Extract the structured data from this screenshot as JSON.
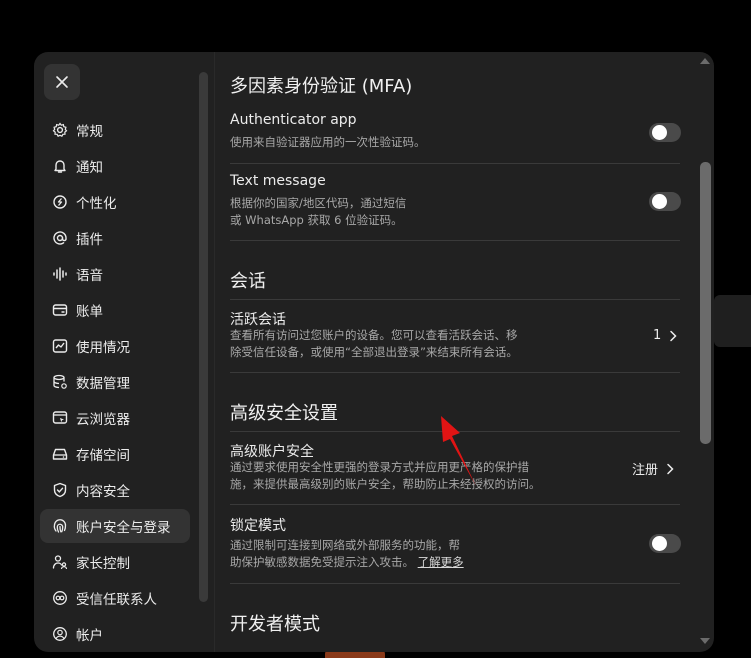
{
  "sidebar": {
    "close_icon": "close-icon",
    "items": [
      {
        "label": "常规",
        "icon": "gear-icon"
      },
      {
        "label": "通知",
        "icon": "bell-icon"
      },
      {
        "label": "个性化",
        "icon": "personalization-icon"
      },
      {
        "label": "插件",
        "icon": "at-icon"
      },
      {
        "label": "语音",
        "icon": "waveform-icon"
      },
      {
        "label": "账单",
        "icon": "card-icon"
      },
      {
        "label": "使用情况",
        "icon": "chart-icon"
      },
      {
        "label": "数据管理",
        "icon": "database-icon"
      },
      {
        "label": "云浏览器",
        "icon": "browser-icon"
      },
      {
        "label": "存储空间",
        "icon": "storage-icon"
      },
      {
        "label": "内容安全",
        "icon": "shield-icon"
      },
      {
        "label": "账户安全与登录",
        "icon": "fingerprint-icon",
        "active": true
      },
      {
        "label": "家长控制",
        "icon": "parent-icon"
      },
      {
        "label": "受信任联系人",
        "icon": "contacts-icon"
      },
      {
        "label": "帐户",
        "icon": "account-icon"
      }
    ]
  },
  "mfa": {
    "title": "多因素身份验证 (MFA)",
    "authenticator": {
      "title": "Authenticator app",
      "desc": "使用来自验证器应用的一次性验证码。",
      "enabled": false
    },
    "sms": {
      "title": "Text message",
      "desc_line1": "根据你的国家/地区代码，通过短信",
      "desc_line2": "或 WhatsApp 获取 6 位验证码。",
      "enabled": false
    }
  },
  "sessions": {
    "title": "会话",
    "active": {
      "title": "活跃会话",
      "desc_line1": "查看所有访问过您账户的设备。您可以查看活跃会话、移",
      "desc_line2": "除受信任设备，或使用“全部退出登录”来结束所有会话。",
      "count": "1"
    }
  },
  "advanced": {
    "title": "高级安全设置",
    "account_security": {
      "title": "高级账户安全",
      "desc_line1": "通过要求使用安全性更强的登录方式并应用更严格的保护措",
      "desc_line2": "施，来提供最高级别的账户安全，帮助防止未经授权的访问。",
      "action": "注册"
    },
    "lockdown": {
      "title": "锁定模式",
      "desc_line1": "通过限制可连接到网络或外部服务的功能，帮",
      "desc_line2": "助保护敏感数据免受提示注入攻击。",
      "link": "了解更多",
      "enabled": false
    }
  },
  "developer": {
    "title": "开发者模式"
  },
  "colors": {
    "background": "#212121",
    "annotation_arrow": "#e11414"
  }
}
